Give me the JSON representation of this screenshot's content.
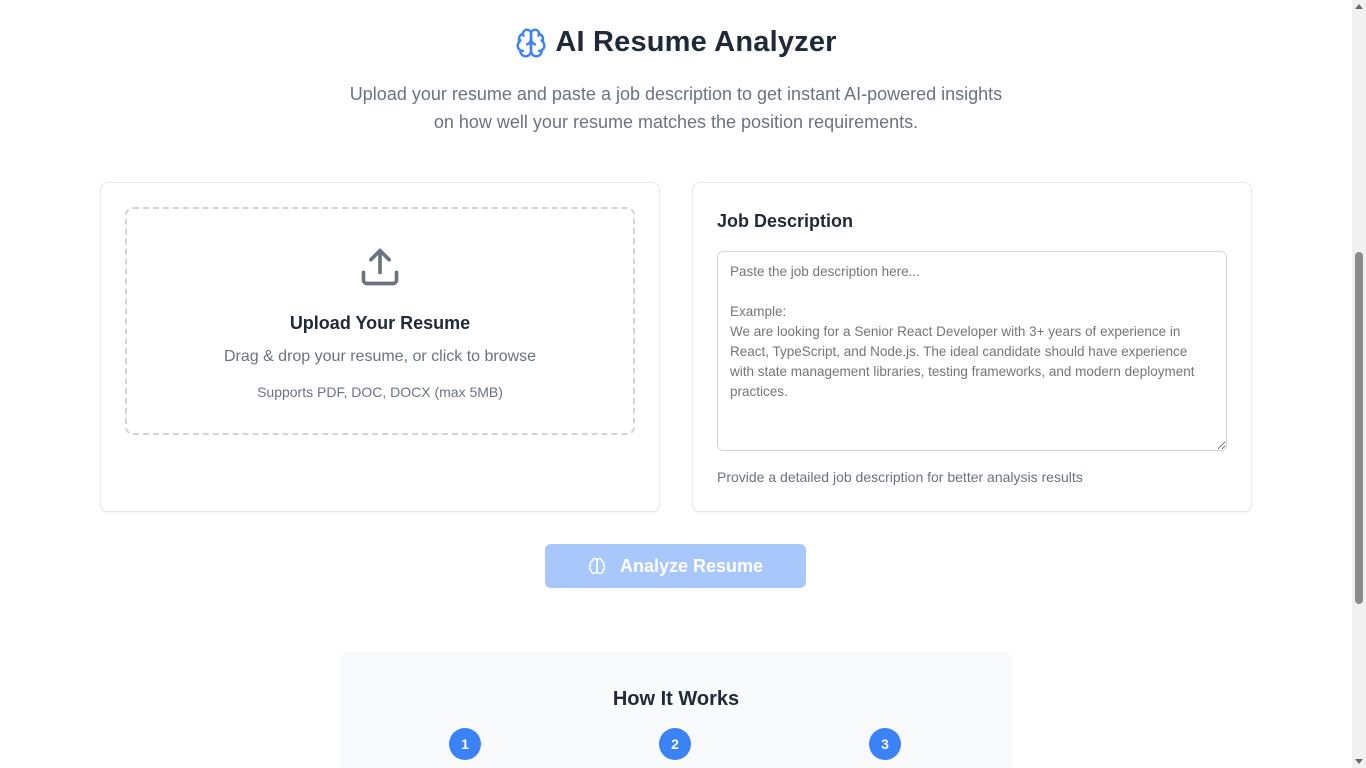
{
  "header": {
    "title": "AI Resume Analyzer",
    "title_icon": "brain-icon",
    "subtitle_line1": "Upload your resume and paste a job description to get instant AI-powered insights",
    "subtitle_line2": "on how well your resume matches the position requirements."
  },
  "upload": {
    "icon": "upload-icon",
    "title": "Upload Your Resume",
    "subtitle": "Drag & drop your resume, or click to browse",
    "note": "Supports PDF, DOC, DOCX (max 5MB)"
  },
  "job": {
    "heading": "Job Description",
    "value": "",
    "placeholder": "Paste the job description here...\n\nExample:\nWe are looking for a Senior React Developer with 3+ years of experience in React, TypeScript, and Node.js. The ideal candidate should have experience with state management libraries, testing frameworks, and modern deployment practices.",
    "hint": "Provide a detailed job description for better analysis results"
  },
  "analyze_button": {
    "label": "Analyze Resume",
    "icon": "brain-icon",
    "disabled": true
  },
  "how_it_works": {
    "title": "How It Works",
    "steps": [
      "1",
      "2",
      "3"
    ]
  },
  "colors": {
    "accent": "#3b82f6",
    "button_disabled": "#a8c7fa",
    "muted_text": "#6b7280"
  }
}
